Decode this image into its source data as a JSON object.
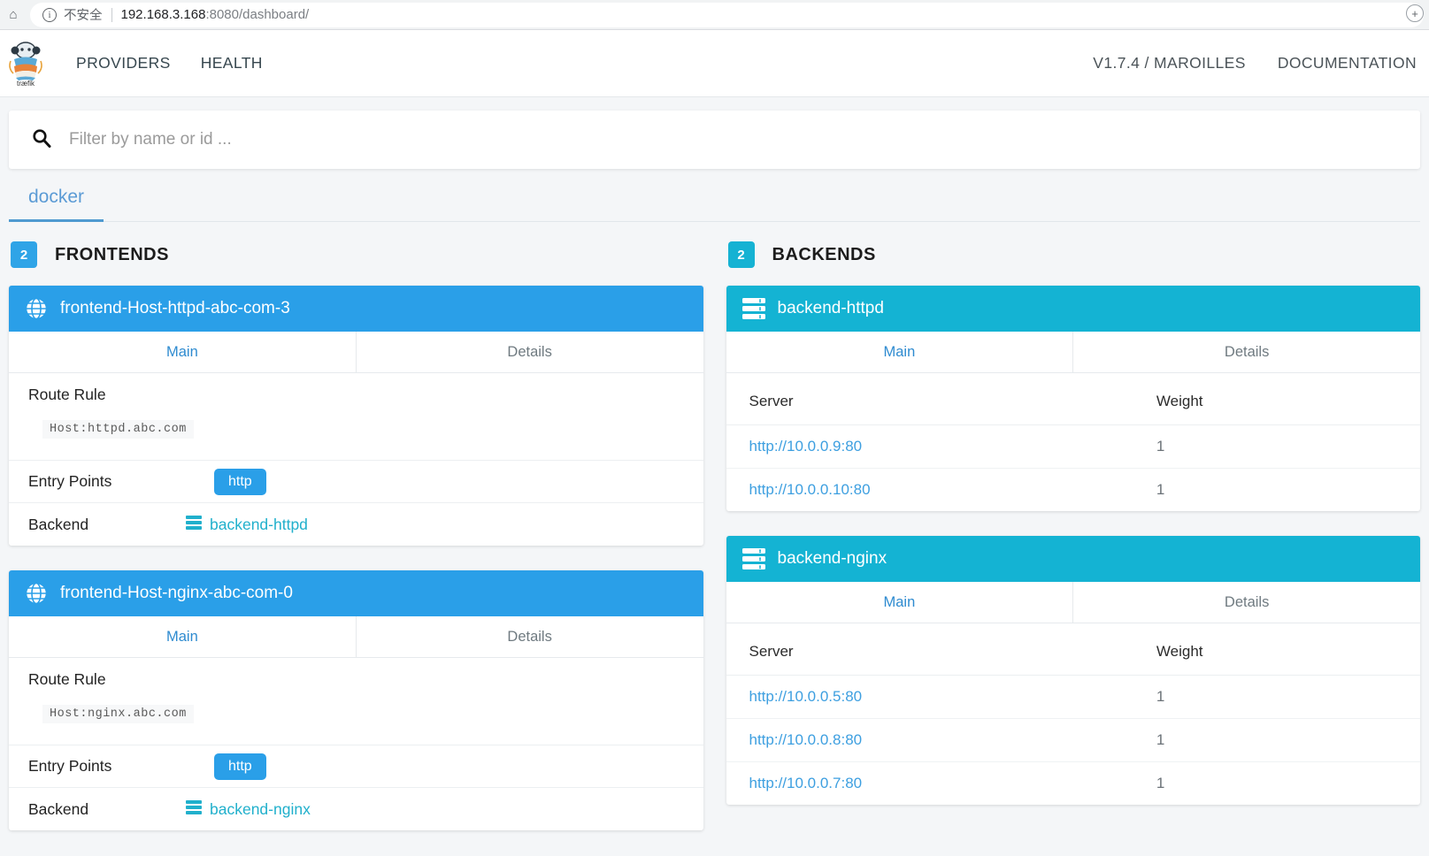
{
  "browser": {
    "home_icon": "home-icon",
    "info_icon": "info-circle-icon",
    "security_label": "不安全",
    "url_host": "192.168.3.168",
    "url_rest": ":8080/dashboard/",
    "extension_icon": "extension-circle-icon"
  },
  "navbar": {
    "logo_alt": "traefik-logo",
    "logo_wordmark": "træfik",
    "links": [
      {
        "label": "PROVIDERS",
        "name": "nav-link-providers"
      },
      {
        "label": "HEALTH",
        "name": "nav-link-health"
      }
    ],
    "right_links": [
      {
        "label": "V1.7.4 / MAROILLES",
        "name": "nav-version"
      },
      {
        "label": "DOCUMENTATION",
        "name": "nav-link-documentation"
      }
    ]
  },
  "search": {
    "icon": "search-icon",
    "placeholder": "Filter by name or id ...",
    "value": ""
  },
  "provider_tabs": [
    {
      "label": "docker",
      "active": true
    }
  ],
  "frontends_section": {
    "count": "2",
    "title": "FRONTENDS",
    "badge_color": "#2fa4e7",
    "header_color": "#2a9fe8",
    "cards": [
      {
        "icon": "globe-icon",
        "title": "frontend-Host-httpd-abc-com-3",
        "tabs": [
          {
            "label": "Main",
            "active": true
          },
          {
            "label": "Details",
            "active": false
          }
        ],
        "route_rule_label": "Route Rule",
        "route_rule_value": "Host:httpd.abc.com",
        "entry_points_label": "Entry Points",
        "entry_points": [
          "http"
        ],
        "backend_label": "Backend",
        "backend_icon": "server-icon",
        "backend_value": "backend-httpd"
      },
      {
        "icon": "globe-icon",
        "title": "frontend-Host-nginx-abc-com-0",
        "tabs": [
          {
            "label": "Main",
            "active": true
          },
          {
            "label": "Details",
            "active": false
          }
        ],
        "route_rule_label": "Route Rule",
        "route_rule_value": "Host:nginx.abc.com",
        "entry_points_label": "Entry Points",
        "entry_points": [
          "http"
        ],
        "backend_label": "Backend",
        "backend_icon": "server-icon",
        "backend_value": "backend-nginx"
      }
    ]
  },
  "backends_section": {
    "count": "2",
    "title": "BACKENDS",
    "badge_color": "#15b2d3",
    "header_color": "#14b3d3",
    "cards": [
      {
        "icon": "server-icon",
        "title": "backend-httpd",
        "tabs": [
          {
            "label": "Main",
            "active": true
          },
          {
            "label": "Details",
            "active": false
          }
        ],
        "columns": [
          "Server",
          "Weight"
        ],
        "rows": [
          {
            "server": "http://10.0.0.9:80",
            "weight": "1"
          },
          {
            "server": "http://10.0.0.10:80",
            "weight": "1"
          }
        ]
      },
      {
        "icon": "server-icon",
        "title": "backend-nginx",
        "tabs": [
          {
            "label": "Main",
            "active": true
          },
          {
            "label": "Details",
            "active": false
          }
        ],
        "columns": [
          "Server",
          "Weight"
        ],
        "rows": [
          {
            "server": "http://10.0.0.5:80",
            "weight": "1"
          },
          {
            "server": "http://10.0.0.8:80",
            "weight": "1"
          },
          {
            "server": "http://10.0.0.7:80",
            "weight": "1"
          }
        ]
      }
    ]
  }
}
